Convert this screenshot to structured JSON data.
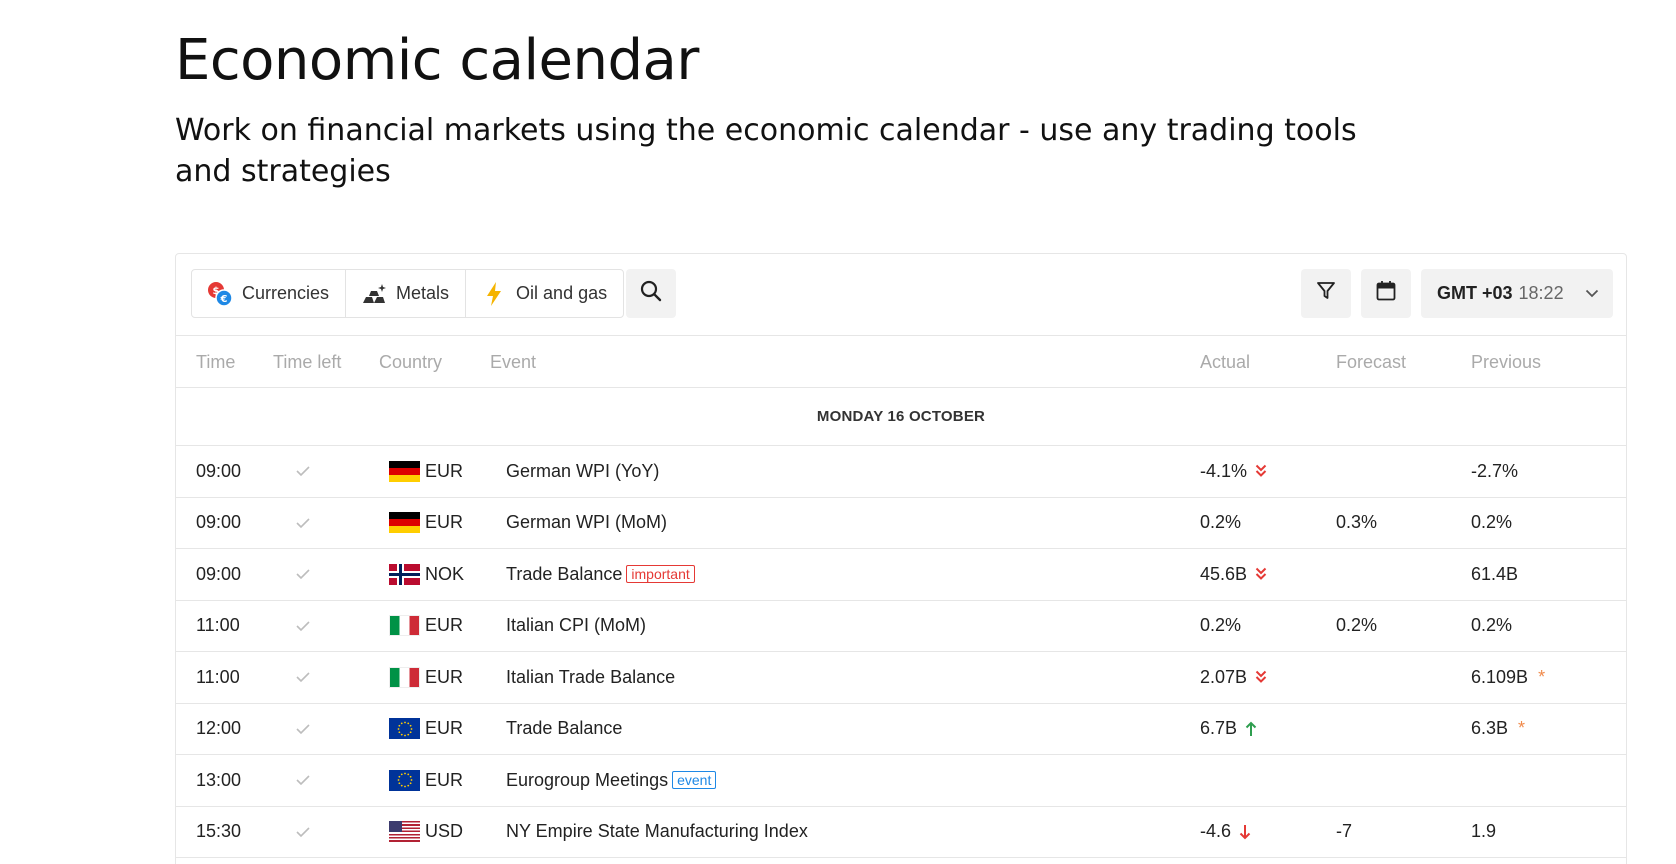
{
  "page": {
    "title": "Economic calendar",
    "subtitle": "Work on financial markets using the economic calendar - use any trading tools and strategies"
  },
  "toolbar": {
    "categories": [
      {
        "label": "Currencies",
        "icon": "currencies-icon"
      },
      {
        "label": "Metals",
        "icon": "metals-icon"
      },
      {
        "label": "Oil and gas",
        "icon": "lightning-icon"
      }
    ],
    "timezone": {
      "label": "GMT +03",
      "time": "18:22"
    }
  },
  "table": {
    "headers": {
      "time": "Time",
      "time_left": "Time left",
      "country": "Country",
      "event": "Event",
      "actual": "Actual",
      "forecast": "Forecast",
      "previous": "Previous"
    },
    "day": "MONDAY 16 OCTOBER",
    "rows": [
      {
        "time": "09:00",
        "flag": "de",
        "currency": "EUR",
        "event": "German WPI (YoY)",
        "badge": "",
        "actual": "-4.1%",
        "trend": "down-double",
        "forecast": "",
        "previous": "-2.7%",
        "revised": false
      },
      {
        "time": "09:00",
        "flag": "de",
        "currency": "EUR",
        "event": "German WPI (MoM)",
        "badge": "",
        "actual": "0.2%",
        "trend": "",
        "forecast": "0.3%",
        "previous": "0.2%",
        "revised": false
      },
      {
        "time": "09:00",
        "flag": "no",
        "currency": "NOK",
        "event": "Trade Balance",
        "badge": "important",
        "actual": "45.6B",
        "trend": "down-double",
        "forecast": "",
        "previous": "61.4B",
        "revised": false
      },
      {
        "time": "11:00",
        "flag": "it",
        "currency": "EUR",
        "event": "Italian CPI (MoM)",
        "badge": "",
        "actual": "0.2%",
        "trend": "",
        "forecast": "0.2%",
        "previous": "0.2%",
        "revised": false
      },
      {
        "time": "11:00",
        "flag": "it",
        "currency": "EUR",
        "event": "Italian Trade Balance",
        "badge": "",
        "actual": "2.07B",
        "trend": "down-double",
        "forecast": "",
        "previous": "6.109B",
        "revised": true
      },
      {
        "time": "12:00",
        "flag": "eu",
        "currency": "EUR",
        "event": "Trade Balance",
        "badge": "",
        "actual": "6.7B",
        "trend": "up",
        "forecast": "",
        "previous": "6.3B",
        "revised": true
      },
      {
        "time": "13:00",
        "flag": "eu",
        "currency": "EUR",
        "event": "Eurogroup Meetings",
        "badge": "event",
        "actual": "",
        "trend": "",
        "forecast": "",
        "previous": "",
        "revised": false
      },
      {
        "time": "15:30",
        "flag": "us",
        "currency": "USD",
        "event": "NY Empire State Manufacturing Index",
        "badge": "",
        "actual": "-4.6",
        "trend": "down",
        "forecast": "-7",
        "previous": "1.9",
        "revised": false
      }
    ]
  },
  "colors": {
    "down": "#e53935",
    "up": "#2e9e4f",
    "revised": "#f08a4b",
    "important": "#e53935",
    "event": "#1e88e5"
  }
}
